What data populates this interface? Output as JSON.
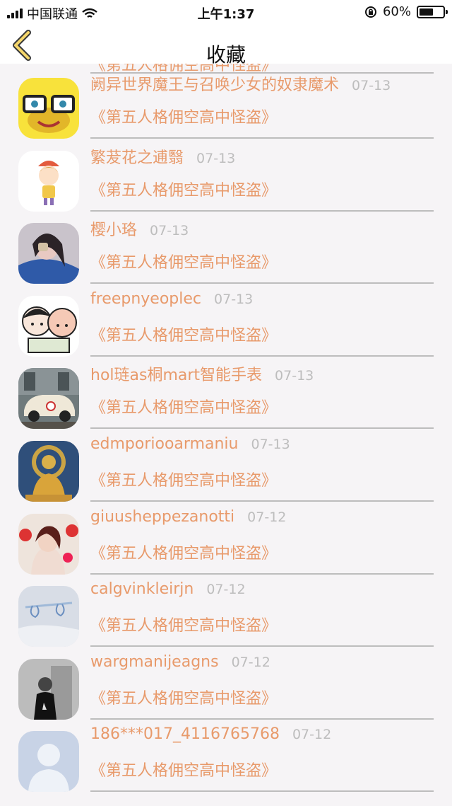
{
  "status_bar": {
    "carrier": "中国联通",
    "time": "上午1:37",
    "battery": "60%",
    "battery_level": 0.6
  },
  "nav": {
    "title": "收藏",
    "back_icon": "chevron-left-icon"
  },
  "partial_top": {
    "book": "《第五人格佣空高中怪盗》"
  },
  "items": [
    {
      "name": "阙异世界魔王与召唤少女的奴隶魔术",
      "date": "07-13",
      "book": "《第五人格佣空高中怪盗》"
    },
    {
      "name": "繁茇花之逋翳",
      "date": "07-13",
      "book": "《第五人格佣空高中怪盗》"
    },
    {
      "name": "樱小珞",
      "date": "07-13",
      "book": "《第五人格佣空高中怪盗》"
    },
    {
      "name": "freepnyeoplec",
      "date": "07-13",
      "book": "《第五人格佣空高中怪盗》"
    },
    {
      "name": "hol琏as桐mart智能手表",
      "date": "07-13",
      "book": "《第五人格佣空高中怪盗》"
    },
    {
      "name": "edmporiooarmaniu",
      "date": "07-13",
      "book": "《第五人格佣空高中怪盗》"
    },
    {
      "name": "giuusheppezanotti",
      "date": "07-12",
      "book": "《第五人格佣空高中怪盗》"
    },
    {
      "name": "calgvinkleirjn",
      "date": "07-12",
      "book": "《第五人格佣空高中怪盗》"
    },
    {
      "name": "wargmanijeagns",
      "date": "07-12",
      "book": "《第五人格佣空高中怪盗》"
    },
    {
      "name": "186***017_4116765768",
      "date": "07-12",
      "book": "《第五人格佣空高中怪盗》"
    }
  ],
  "colors": {
    "accent": "#e89a6b",
    "date": "#bdbdbd",
    "background": "#f6f4f6"
  }
}
